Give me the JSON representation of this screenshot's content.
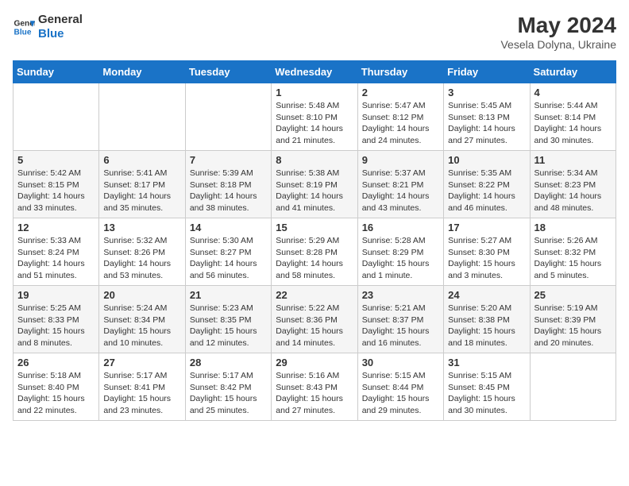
{
  "logo": {
    "line1": "General",
    "line2": "Blue"
  },
  "title": "May 2024",
  "subtitle": "Vesela Dolyna, Ukraine",
  "days_of_week": [
    "Sunday",
    "Monday",
    "Tuesday",
    "Wednesday",
    "Thursday",
    "Friday",
    "Saturday"
  ],
  "weeks": [
    [
      {
        "num": "",
        "info": ""
      },
      {
        "num": "",
        "info": ""
      },
      {
        "num": "",
        "info": ""
      },
      {
        "num": "1",
        "info": "Sunrise: 5:48 AM\nSunset: 8:10 PM\nDaylight: 14 hours and 21 minutes."
      },
      {
        "num": "2",
        "info": "Sunrise: 5:47 AM\nSunset: 8:12 PM\nDaylight: 14 hours and 24 minutes."
      },
      {
        "num": "3",
        "info": "Sunrise: 5:45 AM\nSunset: 8:13 PM\nDaylight: 14 hours and 27 minutes."
      },
      {
        "num": "4",
        "info": "Sunrise: 5:44 AM\nSunset: 8:14 PM\nDaylight: 14 hours and 30 minutes."
      }
    ],
    [
      {
        "num": "5",
        "info": "Sunrise: 5:42 AM\nSunset: 8:15 PM\nDaylight: 14 hours and 33 minutes."
      },
      {
        "num": "6",
        "info": "Sunrise: 5:41 AM\nSunset: 8:17 PM\nDaylight: 14 hours and 35 minutes."
      },
      {
        "num": "7",
        "info": "Sunrise: 5:39 AM\nSunset: 8:18 PM\nDaylight: 14 hours and 38 minutes."
      },
      {
        "num": "8",
        "info": "Sunrise: 5:38 AM\nSunset: 8:19 PM\nDaylight: 14 hours and 41 minutes."
      },
      {
        "num": "9",
        "info": "Sunrise: 5:37 AM\nSunset: 8:21 PM\nDaylight: 14 hours and 43 minutes."
      },
      {
        "num": "10",
        "info": "Sunrise: 5:35 AM\nSunset: 8:22 PM\nDaylight: 14 hours and 46 minutes."
      },
      {
        "num": "11",
        "info": "Sunrise: 5:34 AM\nSunset: 8:23 PM\nDaylight: 14 hours and 48 minutes."
      }
    ],
    [
      {
        "num": "12",
        "info": "Sunrise: 5:33 AM\nSunset: 8:24 PM\nDaylight: 14 hours and 51 minutes."
      },
      {
        "num": "13",
        "info": "Sunrise: 5:32 AM\nSunset: 8:26 PM\nDaylight: 14 hours and 53 minutes."
      },
      {
        "num": "14",
        "info": "Sunrise: 5:30 AM\nSunset: 8:27 PM\nDaylight: 14 hours and 56 minutes."
      },
      {
        "num": "15",
        "info": "Sunrise: 5:29 AM\nSunset: 8:28 PM\nDaylight: 14 hours and 58 minutes."
      },
      {
        "num": "16",
        "info": "Sunrise: 5:28 AM\nSunset: 8:29 PM\nDaylight: 15 hours and 1 minute."
      },
      {
        "num": "17",
        "info": "Sunrise: 5:27 AM\nSunset: 8:30 PM\nDaylight: 15 hours and 3 minutes."
      },
      {
        "num": "18",
        "info": "Sunrise: 5:26 AM\nSunset: 8:32 PM\nDaylight: 15 hours and 5 minutes."
      }
    ],
    [
      {
        "num": "19",
        "info": "Sunrise: 5:25 AM\nSunset: 8:33 PM\nDaylight: 15 hours and 8 minutes."
      },
      {
        "num": "20",
        "info": "Sunrise: 5:24 AM\nSunset: 8:34 PM\nDaylight: 15 hours and 10 minutes."
      },
      {
        "num": "21",
        "info": "Sunrise: 5:23 AM\nSunset: 8:35 PM\nDaylight: 15 hours and 12 minutes."
      },
      {
        "num": "22",
        "info": "Sunrise: 5:22 AM\nSunset: 8:36 PM\nDaylight: 15 hours and 14 minutes."
      },
      {
        "num": "23",
        "info": "Sunrise: 5:21 AM\nSunset: 8:37 PM\nDaylight: 15 hours and 16 minutes."
      },
      {
        "num": "24",
        "info": "Sunrise: 5:20 AM\nSunset: 8:38 PM\nDaylight: 15 hours and 18 minutes."
      },
      {
        "num": "25",
        "info": "Sunrise: 5:19 AM\nSunset: 8:39 PM\nDaylight: 15 hours and 20 minutes."
      }
    ],
    [
      {
        "num": "26",
        "info": "Sunrise: 5:18 AM\nSunset: 8:40 PM\nDaylight: 15 hours and 22 minutes."
      },
      {
        "num": "27",
        "info": "Sunrise: 5:17 AM\nSunset: 8:41 PM\nDaylight: 15 hours and 23 minutes."
      },
      {
        "num": "28",
        "info": "Sunrise: 5:17 AM\nSunset: 8:42 PM\nDaylight: 15 hours and 25 minutes."
      },
      {
        "num": "29",
        "info": "Sunrise: 5:16 AM\nSunset: 8:43 PM\nDaylight: 15 hours and 27 minutes."
      },
      {
        "num": "30",
        "info": "Sunrise: 5:15 AM\nSunset: 8:44 PM\nDaylight: 15 hours and 29 minutes."
      },
      {
        "num": "31",
        "info": "Sunrise: 5:15 AM\nSunset: 8:45 PM\nDaylight: 15 hours and 30 minutes."
      },
      {
        "num": "",
        "info": ""
      }
    ]
  ]
}
